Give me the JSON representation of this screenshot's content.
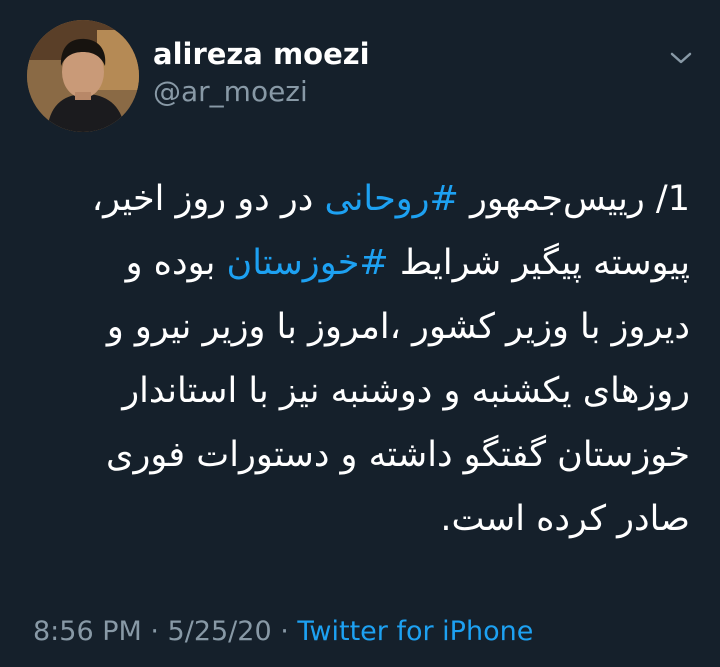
{
  "user": {
    "display_name": "alireza moezi",
    "handle": "@ar_moezi",
    "avatar_icon": "avatar-photo"
  },
  "menu": {
    "icon": "chevron-down-icon"
  },
  "tweet": {
    "lines": [
      {
        "before": "1/ رییس‌جمهور ",
        "hashtag": "#روحانی",
        "after": " در دو روز اخیر،"
      },
      {
        "before": "پیوسته پیگیر شرایط ",
        "hashtag": "#خوزستان",
        "after": " بوده و"
      },
      {
        "text": "دیروز با وزیر کشور ،امروز با وزیر نیرو و"
      },
      {
        "text": "روزهای یکشنبه و دوشنبه نیز با استاندار"
      },
      {
        "text": "خوزستان گفتگو داشته و دستورات فوری"
      },
      {
        "text": "صادر کرده است."
      }
    ]
  },
  "meta": {
    "time": "8:56 PM",
    "separator1": " · ",
    "date": "5/25/20",
    "separator2": " · ",
    "source": "Twitter for iPhone"
  },
  "colors": {
    "background": "#15202b",
    "text": "#ffffff",
    "secondary": "#8899a6",
    "accent": "#1da1f2"
  }
}
